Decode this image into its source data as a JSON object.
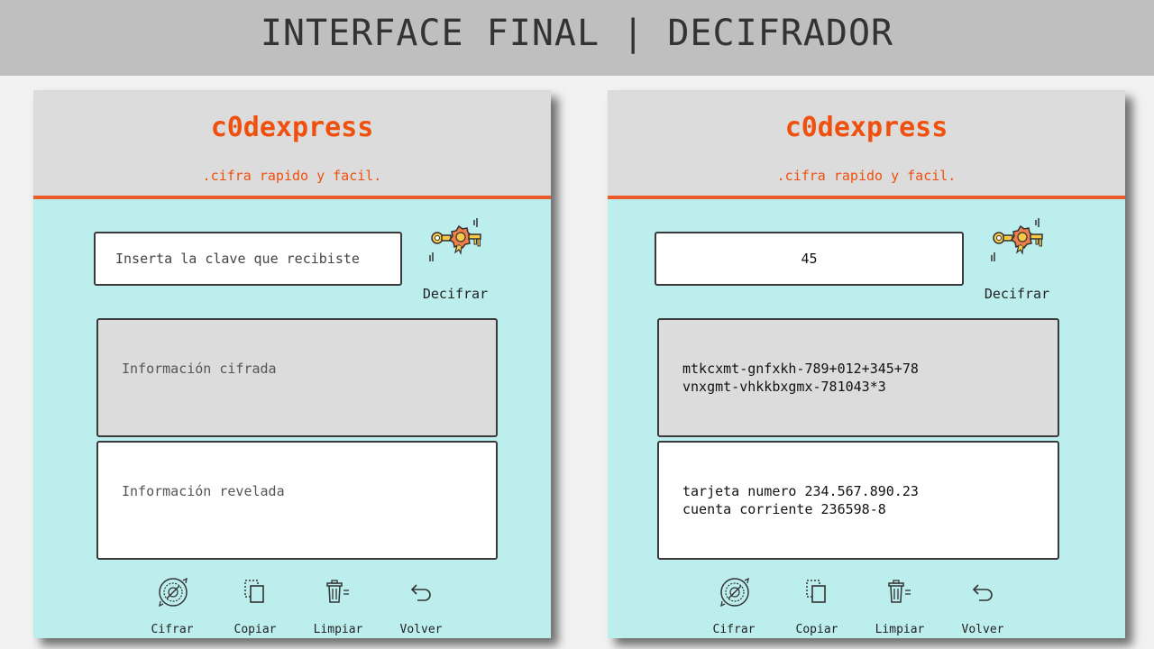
{
  "banner": {
    "title": "INTERFACE FINAL | DECIFRADOR"
  },
  "colors": {
    "accent": "#f0500e",
    "panel_bg": "#bdeeee",
    "header_bg": "#dcdcdc",
    "banner_bg": "#bfbfbf"
  },
  "left_panel": {
    "brand": "c0dexpress",
    "tagline": ".cifra rapido y facil.",
    "key_input": {
      "value": "",
      "placeholder": "Inserta la clave que recibiste"
    },
    "decrypt_button": {
      "label": "Decifrar",
      "icon": "key-icon"
    },
    "cipher_area": {
      "value": "",
      "placeholder": "Información cifrada"
    },
    "reveal_area": {
      "value": "",
      "placeholder": "Información revelada"
    },
    "toolbar": [
      {
        "label": "Cifrar",
        "icon": "cipher-wheel-icon"
      },
      {
        "label": "Copiar",
        "icon": "copy-icon"
      },
      {
        "label": "Limpiar",
        "icon": "trash-icon"
      },
      {
        "label": "Volver",
        "icon": "undo-arrow-icon"
      }
    ]
  },
  "right_panel": {
    "brand": "c0dexpress",
    "tagline": ".cifra rapido y facil.",
    "key_input": {
      "value": "45",
      "placeholder": ""
    },
    "decrypt_button": {
      "label": "Decifrar",
      "icon": "key-icon"
    },
    "cipher_area": {
      "value": "mtkcxmt-gnfxkh-789+012+345+78\nvnxgmt-vhkkbxgmx-781043*3",
      "placeholder": ""
    },
    "reveal_area": {
      "value": "tarjeta numero 234.567.890.23\ncuenta corriente 236598-8",
      "placeholder": ""
    },
    "toolbar": [
      {
        "label": "Cifrar",
        "icon": "cipher-wheel-icon"
      },
      {
        "label": "Copiar",
        "icon": "copy-icon"
      },
      {
        "label": "Limpiar",
        "icon": "trash-icon"
      },
      {
        "label": "Volver",
        "icon": "undo-arrow-icon"
      }
    ]
  }
}
